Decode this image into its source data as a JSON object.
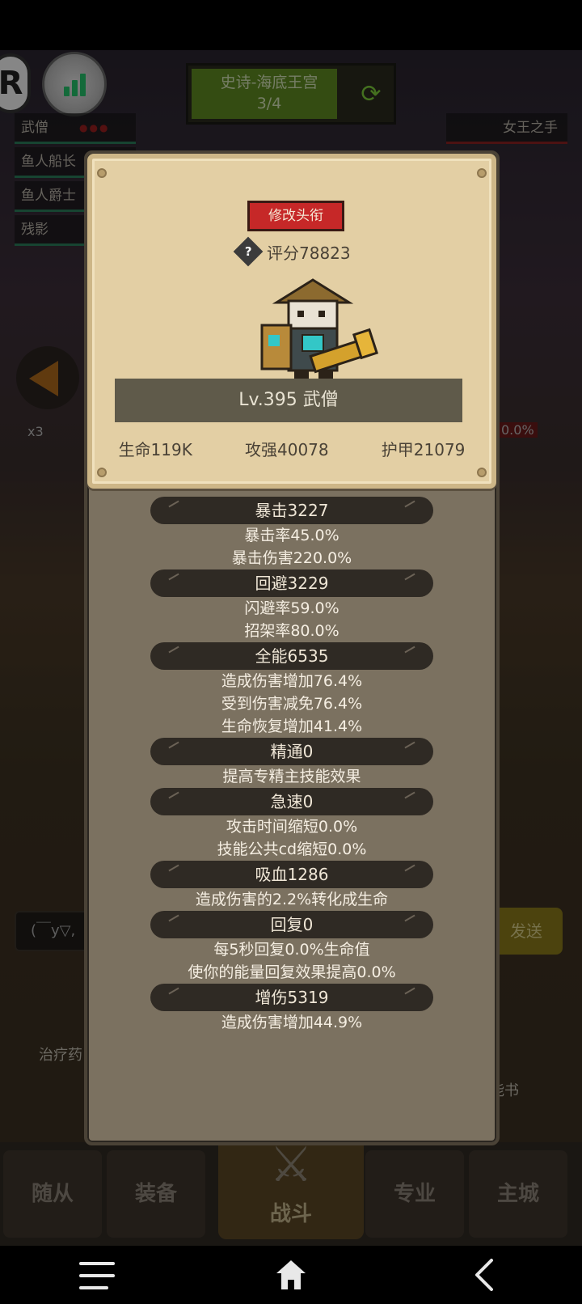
{
  "background": {
    "stage": {
      "title": "史诗-海底王宫",
      "progress": "3/4"
    },
    "team": [
      "武僧",
      "鱼人船长",
      "鱼人爵士",
      "残影"
    ],
    "enemy": "女王之手",
    "multiplier": "x3",
    "percent": "0.0%",
    "chat_placeholder": "(￣y▽,",
    "send_label": "发送",
    "left_item_label": "治疗药",
    "right_item_label": "能书"
  },
  "tabs": [
    "随从",
    "装备",
    "战斗",
    "专业",
    "主城"
  ],
  "modal": {
    "title_button": "修改头衔",
    "rating": "评分78823",
    "hero_name": "Lv.395 武僧",
    "core_stats": [
      "生命119K",
      "攻强40078",
      "护甲21079"
    ],
    "sections": [
      {
        "head": "暴击3227",
        "lines": [
          "暴击率45.0%",
          "暴击伤害220.0%"
        ]
      },
      {
        "head": "回避3229",
        "lines": [
          "闪避率59.0%",
          "招架率80.0%"
        ]
      },
      {
        "head": "全能6535",
        "lines": [
          "造成伤害增加76.4%",
          "受到伤害减免76.4%",
          "生命恢复增加41.4%"
        ]
      },
      {
        "head": "精通0",
        "lines": [
          "提高专精主技能效果"
        ]
      },
      {
        "head": "急速0",
        "lines": [
          "攻击时间缩短0.0%",
          "技能公共cd缩短0.0%"
        ]
      },
      {
        "head": "吸血1286",
        "lines": [
          "造成伤害的2.2%转化成生命"
        ]
      },
      {
        "head": "回复0",
        "lines": [
          "每5秒回复0.0%生命值",
          "使你的能量回复效果提高0.0%"
        ]
      },
      {
        "head": "增伤5319",
        "lines": [
          "造成伤害增加44.9%"
        ]
      }
    ]
  },
  "colors": {
    "title_button": "#c62828",
    "card": "#e3cfa4",
    "panel": "#7b7160",
    "stat_head": "#2f2a24"
  }
}
